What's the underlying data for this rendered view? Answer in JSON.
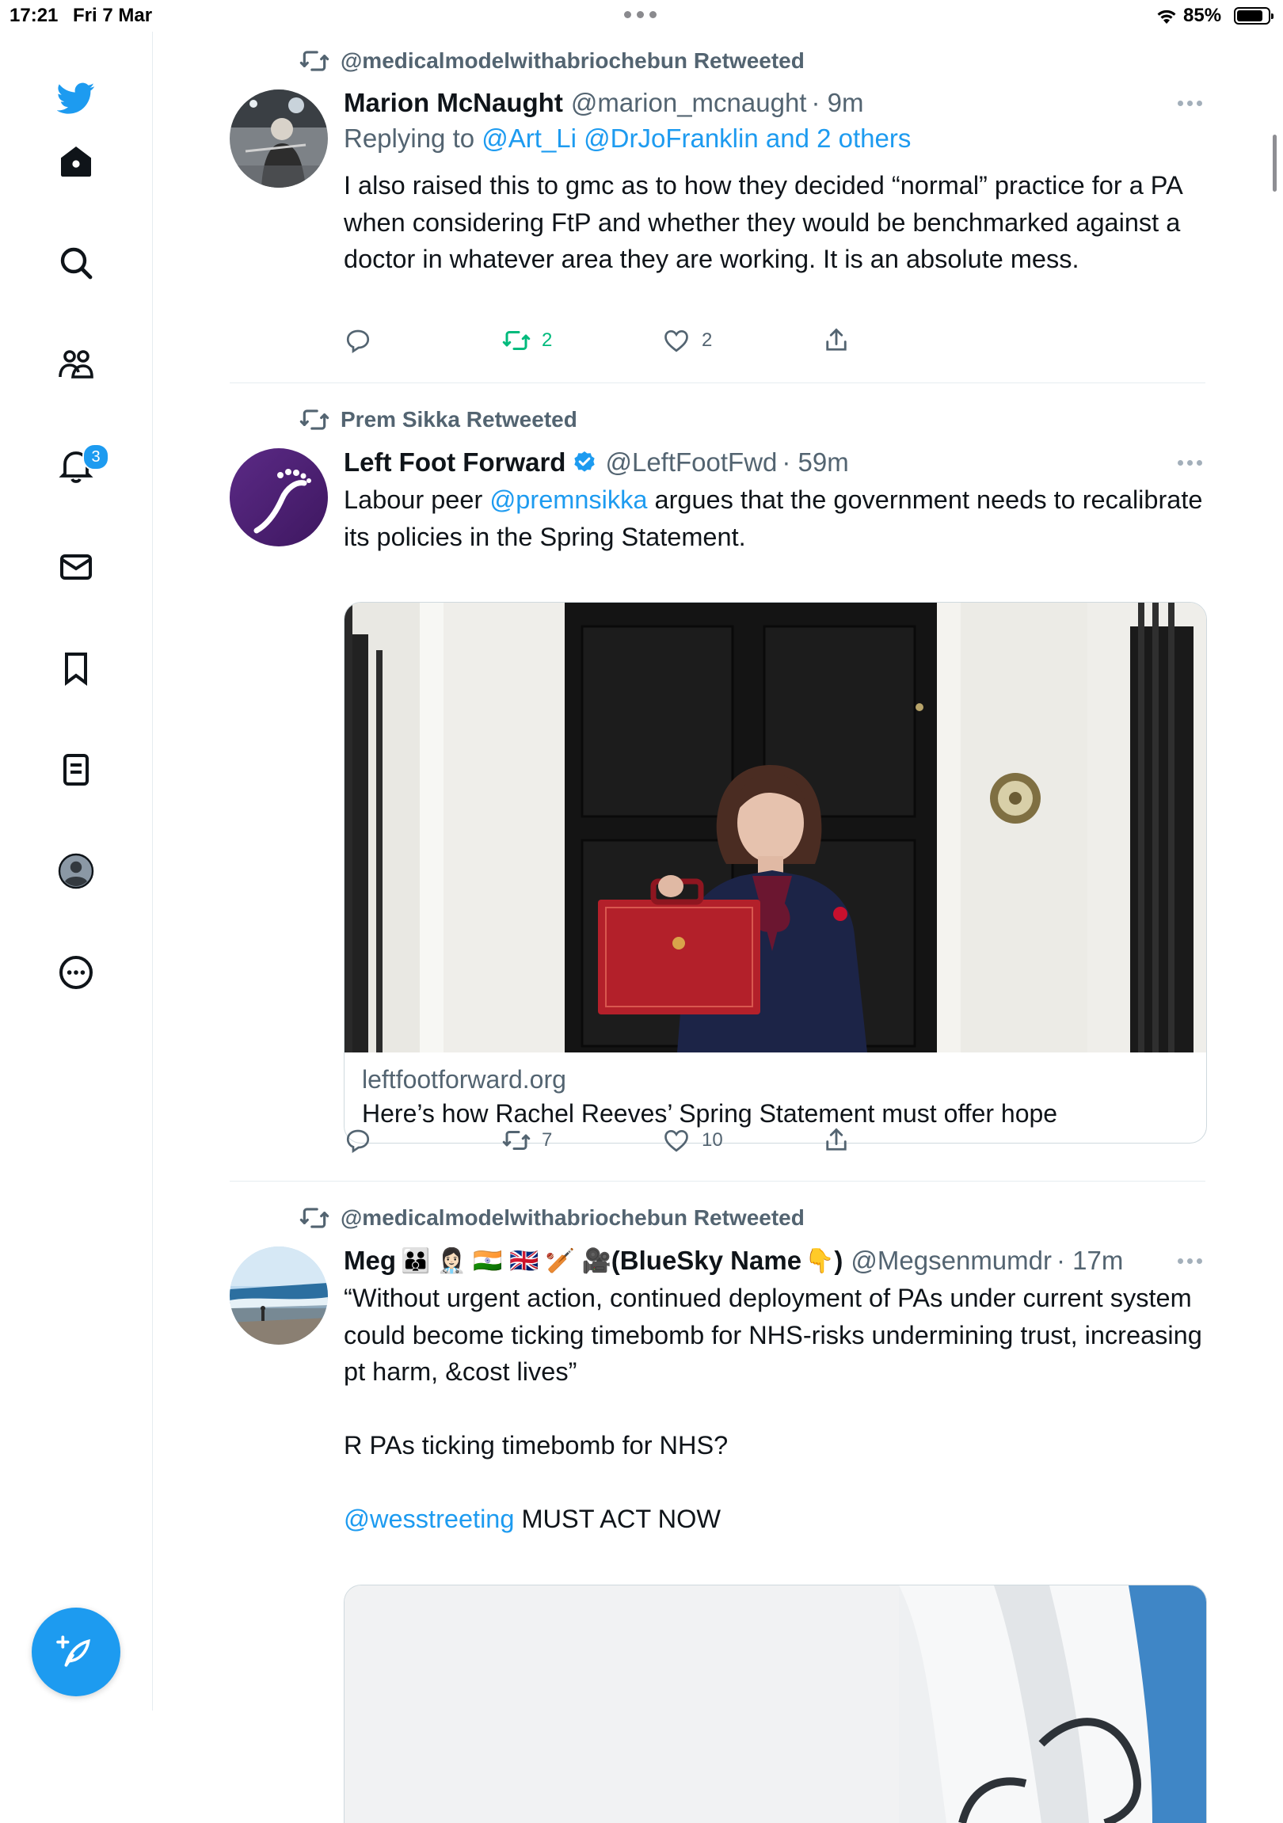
{
  "status_bar": {
    "time": "17:21",
    "date": "Fri 7 Mar",
    "battery": "85%",
    "battery_level": 0.85
  },
  "sidebar": {
    "items": [
      {
        "name": "home"
      },
      {
        "name": "explore"
      },
      {
        "name": "communities"
      },
      {
        "name": "notifications",
        "badge": "3"
      },
      {
        "name": "messages"
      },
      {
        "name": "bookmarks"
      },
      {
        "name": "lists"
      },
      {
        "name": "profile"
      },
      {
        "name": "more"
      }
    ]
  },
  "colors": {
    "accent": "#1d9bf0",
    "retweet_active": "#00ba7c",
    "secondary_text": "#536471"
  },
  "tweets": [
    {
      "retweeted_by": "@medicalmodelwithabriochebun Retweeted",
      "name": "Marion McNaught",
      "handle": "@marion_mcnaught",
      "time": "· 9m",
      "replying_label": "Replying to",
      "replying_to": "@Art_Li @DrJoFranklin and 2 others",
      "text": "I also raised this to gmc as to how they decided “normal” practice for a PA when considering FtP and whether they would be benchmarked against a doctor in whatever area they are working. It is an absolute mess.",
      "retweets": "2",
      "likes": "2"
    },
    {
      "retweeted_by": "Prem Sikka Retweeted",
      "name": "Left Foot Forward",
      "handle": "@LeftFootFwd",
      "time": "· 59m",
      "text_before": "Labour peer ",
      "mention": "@premnsikka",
      "text_after": " argues that the government needs to recalibrate its policies in the Spring Statement.",
      "card_domain": "leftfootforward.org",
      "card_title": "Here’s how Rachel Reeves’ Spring Statement must offer hope",
      "retweets": "7",
      "likes": "10"
    },
    {
      "retweeted_by": "@medicalmodelwithabriochebun Retweeted",
      "name": "Meg",
      "name_emojis": "👪 👩🏻‍⚕️ 🇮🇳 🇬🇧 🏏 🎥",
      "name_suffix": "(BlueSky Name",
      "name_pointer": "👇",
      "name_close": ")",
      "handle": "@Megsenmumdr",
      "time": "· 17m",
      "text": "“Without urgent action, continued deployment of PAs under current system could become ticking timebomb for NHS-risks undermining trust, increasing pt harm, &cost lives”",
      "text2": "R PAs ticking timebomb for NHS?",
      "mention": "@wesstreeting",
      "text3": " MUST ACT NOW"
    }
  ]
}
